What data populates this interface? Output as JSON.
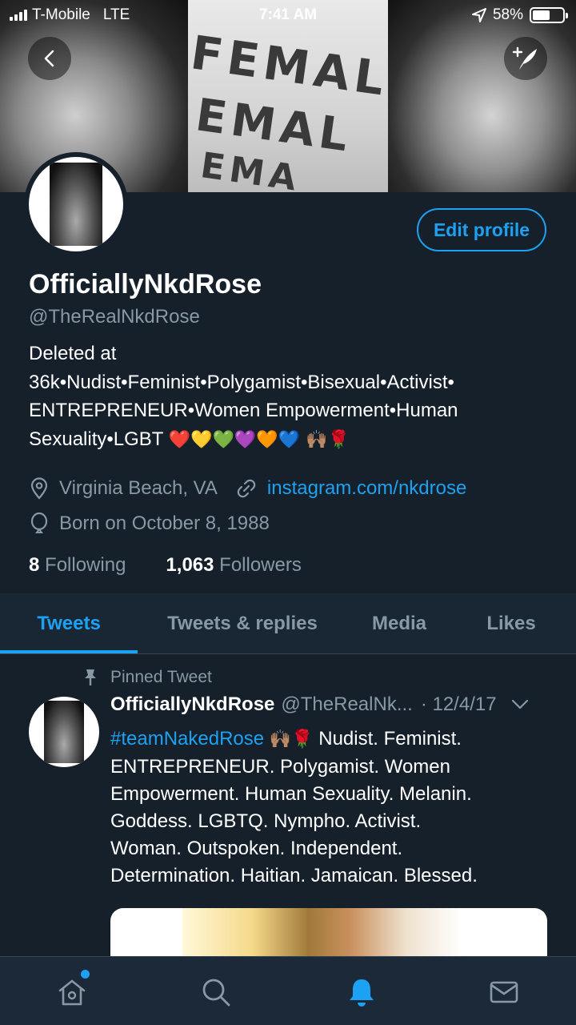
{
  "status_bar": {
    "carrier": "T-Mobile",
    "network": "LTE",
    "time": "7:41 AM",
    "battery": "58%",
    "battery_level": 0.58
  },
  "banner": {
    "shirt_lines": [
      "FEMAL",
      "EMAL",
      "EMA"
    ]
  },
  "header": {
    "back_icon": "chevron-left-icon",
    "compose_icon": "compose-tweet-icon",
    "edit_profile_label": "Edit profile"
  },
  "profile": {
    "display_name": "OfficiallyNkdRose",
    "handle": "@TheRealNkdRose",
    "bio_lines": [
      "Deleted at",
      "36k•Nudist•Feminist•Polygamist•Bisexual•Activist•",
      "ENTREPRENEUR•Women Empowerment•Human"
    ],
    "bio_last_line_text": "Sexuality•LGBT",
    "bio_emoji": "❤️💛💚💜🧡💙 🙌🏽🌹",
    "location": "Virginia Beach, VA",
    "website": "instagram.com/nkdrose",
    "birthday": "Born on October 8, 1988",
    "following_count": "8",
    "following_label": "Following",
    "followers_count": "1,063",
    "followers_label": "Followers"
  },
  "tabs": [
    {
      "label": "Tweets",
      "active": true
    },
    {
      "label": "Tweets & replies",
      "active": false
    },
    {
      "label": "Media",
      "active": false
    },
    {
      "label": "Likes",
      "active": false
    }
  ],
  "pinned_tweet": {
    "pinned_label": "Pinned Tweet",
    "name": "OfficiallyNkdRose",
    "handle": "@TheRealNk...",
    "date": "· 12/4/17",
    "hashtag": "#teamNakedRose",
    "emoji": "🙌🏽🌹",
    "first_line_rest": "Nudist. Feminist.",
    "lines": [
      "ENTREPRENEUR. Polygamist. Women",
      "Empowerment. Human Sexuality. Melanin.",
      "Goddess. LGBTQ. Nympho. Activist.",
      "Woman. Outspoken. Independent.",
      "Determination. Haitian. Jamaican. Blessed."
    ]
  },
  "bottom_nav": {
    "items": [
      "home-icon",
      "search-icon",
      "notifications-icon",
      "messages-icon"
    ],
    "active": "notifications-icon"
  },
  "colors": {
    "background": "#15202b",
    "accent": "#1da1f2",
    "secondary_text": "#8899a6",
    "tab_bar": "#192734",
    "nav_bar": "#1c2938"
  }
}
